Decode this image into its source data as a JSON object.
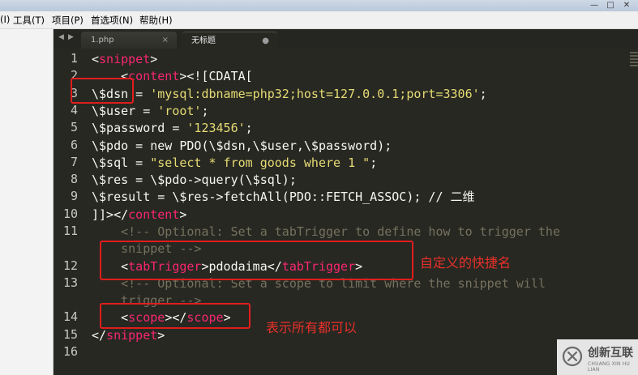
{
  "window": {
    "controls": [
      "—",
      "□",
      "✕"
    ]
  },
  "menu": {
    "items": [
      "(I)",
      "工具(T)",
      "项目(P)",
      "首选项(N)",
      "帮助(H)"
    ]
  },
  "tabs": {
    "nav_prev": "◀",
    "nav_next": "▶",
    "items": [
      {
        "label": "1.php",
        "close": "×",
        "active": false
      },
      {
        "label": "无标题",
        "close": "●",
        "active": true
      }
    ]
  },
  "editor": {
    "line_numbers": [
      "1",
      "2",
      "3",
      "4",
      "5",
      "6",
      "7",
      "8",
      "9",
      "10",
      "11",
      "",
      "12",
      "13",
      "",
      "14",
      "15",
      "16"
    ],
    "lines": {
      "l1_open": "<",
      "l1_tag": "snippet",
      "l1_close": ">",
      "l2_indent": "    ",
      "l2_open": "<",
      "l2_tag": "content",
      "l2_rest": "><![CDATA[",
      "l3_a": "\\$dsn = ",
      "l3_str": "'mysql:dbname=php32;host=127.0.0.1;port=3306'",
      "l3_end": ";",
      "l4_a": "\\$user = ",
      "l4_str": "'root'",
      "l4_end": ";",
      "l5_a": "\\$password = ",
      "l5_str": "'123456'",
      "l5_end": ";",
      "l6": "\\$pdo = new PDO(\\$dsn,\\$user,\\$password);",
      "l7_a": "\\$sql = ",
      "l7_str": "\"select * from goods where 1 \"",
      "l7_end": ";",
      "l8": "\\$res = \\$pdo->query(\\$sql);",
      "l9": "\\$result = \\$res->fetchAll(PDO::FETCH_ASSOC); // 二维",
      "l10_a": "]]></",
      "l10_tag": "content",
      "l10_end": ">",
      "l11a": "    <!-- Optional: Set a tabTrigger to define how to trigger the",
      "l11b": "    snippet -->",
      "l12_indent": "    ",
      "l12_open": "<",
      "l12_tag1": "tabTrigger",
      "l12_mid": ">pdodaima</",
      "l12_tag2": "tabTrigger",
      "l12_close": ">",
      "l13a": "    <!-- Optional: Set a scope to limit where the snippet will",
      "l13b": "    trigger -->",
      "l14_indent": "    ",
      "l14_open": "<",
      "l14_tag1": "scope",
      "l14_mid": "></",
      "l14_tag2": "scope",
      "l14_close": ">",
      "l15_a": "</",
      "l15_tag": "snippet",
      "l15_close": ">"
    }
  },
  "annotations": {
    "shortcut_name": "自定义的快捷名",
    "scope_note": "表示所有都可以"
  },
  "watermark": {
    "cn": "创新互联",
    "en": "CHUANG XIN HU LIAN"
  },
  "colors": {
    "editor_bg": "#272822",
    "tag": "#f92672",
    "string": "#e6db74",
    "comment": "#75715e",
    "annotation_red": "#e01d1d"
  }
}
